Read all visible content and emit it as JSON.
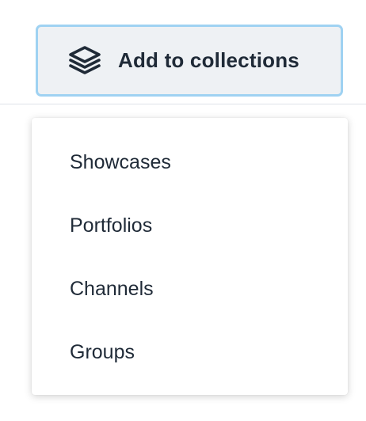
{
  "toolbar": {
    "add_button": {
      "label": "Add to collections",
      "icon": "layers-icon"
    }
  },
  "collections_menu": {
    "items": [
      {
        "label": "Showcases"
      },
      {
        "label": "Portfolios"
      },
      {
        "label": "Channels"
      },
      {
        "label": "Groups"
      }
    ]
  },
  "colors": {
    "button_border": "#9fd2f2",
    "button_background": "#eef1f4",
    "text": "#1f2a37"
  }
}
